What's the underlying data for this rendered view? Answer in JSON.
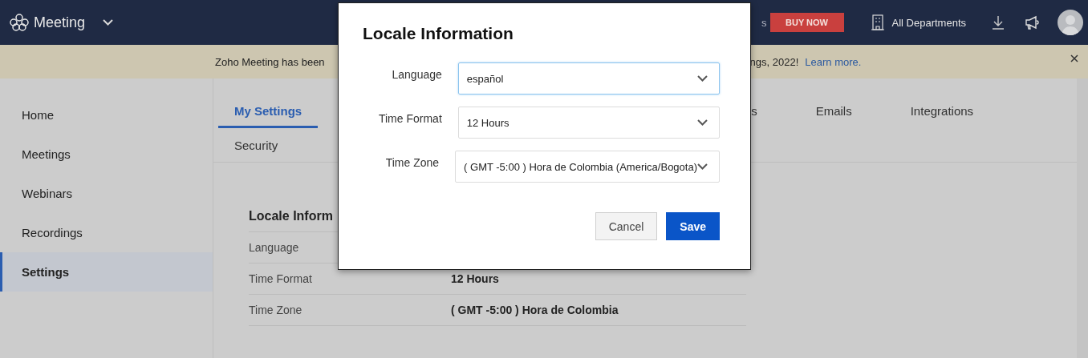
{
  "header": {
    "app_name": "Meeting",
    "partial_text": "s",
    "buy_button": "BUY NOW",
    "department": "All Departments"
  },
  "banner": {
    "text_start": "Zoho Meeting has been",
    "text_end": "ngs, 2022!",
    "link": "Learn more."
  },
  "sidebar": {
    "items": [
      {
        "label": "Home",
        "selected": false
      },
      {
        "label": "Meetings",
        "selected": false
      },
      {
        "label": "Webinars",
        "selected": false
      },
      {
        "label": "Recordings",
        "selected": false
      },
      {
        "label": "Settings",
        "selected": true
      }
    ]
  },
  "tabs": [
    {
      "label": "My Settings",
      "selected": true
    },
    {
      "label": "s",
      "selected": false
    },
    {
      "label": "Emails",
      "selected": false
    },
    {
      "label": "Integrations",
      "selected": false
    }
  ],
  "subtabs": [
    {
      "label": "Security",
      "selected": false
    }
  ],
  "section": {
    "title": "Locale Inform",
    "rows": [
      {
        "label": "Language"
      },
      {
        "label": "Time Format",
        "value": "12 Hours"
      },
      {
        "label": "Time Zone",
        "value": "( GMT -5:00 ) Hora de Colombia"
      }
    ]
  },
  "dialog": {
    "title": "Locale Information",
    "fields": [
      {
        "label": "Language",
        "value": "español",
        "focused": true
      },
      {
        "label": "Time Format",
        "value": "12 Hours",
        "focused": false
      },
      {
        "label": "Time Zone",
        "value": "( GMT -5:00 ) Hora de Colombia (America/Bogota)",
        "focused": false
      }
    ],
    "buttons": [
      {
        "label": "Cancel",
        "kind": "secondary"
      },
      {
        "label": "Save",
        "kind": "primary"
      }
    ]
  }
}
